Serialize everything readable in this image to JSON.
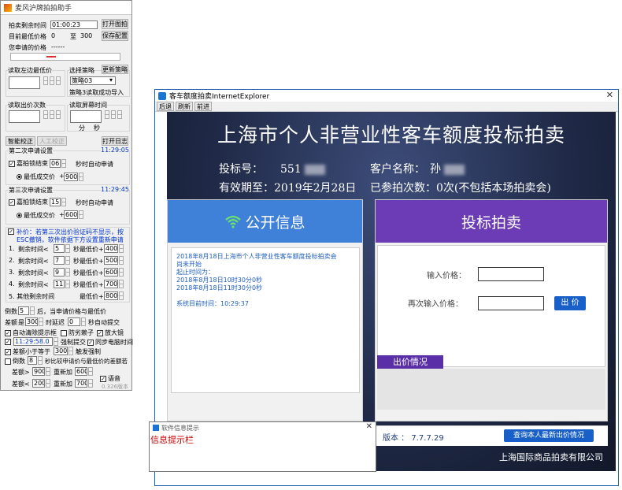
{
  "assistant": {
    "title": "麦风沪牌拍拍助手",
    "remaining_label": "拍卖剩余时间",
    "remaining_value": "01:00:23",
    "open_image_btn": "打开图拍",
    "min_price_label": "目前最低价格",
    "min_price_value": "0",
    "range_sep": "至",
    "range_value": "300",
    "save_config_btn": "保存配置",
    "applied_price_label": "您申请的价格",
    "applied_price_value": "------",
    "read_min_label": "读取左边最低价",
    "strategy_label": "选择策略",
    "update_strategy_btn": "更新策略",
    "strategy_value": "策略03",
    "strategy_status": "策略3读取成功导入",
    "read_bid_label": "读取出价次数",
    "read_screen_label": "读取屏幕时间",
    "minute_label": "分",
    "second_label": "秒",
    "calibrate_btn": "智能校正",
    "manual_btn": "人工校正",
    "open_log_btn": "打开日志",
    "second_apply": {
      "label": "第二次申请设置",
      "time": "11:29:05",
      "end_label": "嘉拍锁结束",
      "end_value": "06",
      "auto_label": "秒时自动申请",
      "lowest_label": "最低成交价",
      "plus": "+",
      "add_value": "900"
    },
    "third_apply": {
      "label": "第三次申请设置",
      "time": "11:29:45",
      "end_label": "嘉拍锁结束",
      "end_value": "15",
      "auto_label": "秒时自动申请",
      "lowest_label": "最低成交价",
      "plus": "+",
      "add_value": "600"
    },
    "supplement_text_1": "补价：若第三次出价验证码不显示，按",
    "supplement_text_2": "ESC撤销，软件依据下方设置重新申请",
    "rules": [
      {
        "n": "1.",
        "label": "剩余时间<",
        "sec": "5",
        "mid": "秒最低价+",
        "add": "400"
      },
      {
        "n": "2.",
        "label": "剩余时间<",
        "sec": "7",
        "mid": "秒最低价+",
        "add": "500"
      },
      {
        "n": "3.",
        "label": "剩余时间<",
        "sec": "9",
        "mid": "秒最低价+",
        "add": "600"
      },
      {
        "n": "4.",
        "label": "剩余时间<",
        "sec": "11",
        "mid": "秒最低价+",
        "add": "700"
      }
    ],
    "rule5_label": "5.  其他剩余时间",
    "rule5_mid": "最低价+",
    "rule5_value": "800",
    "countdown_label": "倒数",
    "countdown_value": "5",
    "countdown_text": "后，当申请价格与最低价",
    "diff_label": "差额",
    "diff_op": "是",
    "diff_value": "300",
    "delay_label": "时延迟",
    "delay_value": "0",
    "auto_submit": "秒自动提交",
    "auto_clear": "自动清除提示框",
    "anti_ai": "防劣赖子",
    "zoom": "放大镜",
    "force_time": "11:29:58.0",
    "force_submit": "强制提交",
    "sync_time": "同步电脑时间",
    "diff_small_label": "差额小于等于",
    "diff_small_value": "300",
    "force_trigger": "触发强制",
    "countdown2_label": "倒数",
    "countdown2_value": "8",
    "countdown2_text": "秒比较申请价与最低价的差额若",
    "gt_label": "差额>",
    "gt_value": "900",
    "gt_add": "重新加",
    "gt_add_value": "600",
    "lt_label": "差额<",
    "lt_value": "200",
    "lt_add": "重新加",
    "lt_add_value": "700",
    "voice_label": "语音",
    "version": "0.326版本"
  },
  "ie": {
    "title": "客车额度拍卖InternetExplorer",
    "nav": [
      "后退",
      "刷新",
      "前进"
    ],
    "heading": "上海市个人非营业性客车额度投标拍卖",
    "bid_no_label": "投标号：",
    "bid_no_value": "551",
    "customer_label": "客户名称：",
    "customer_value": "孙",
    "valid_label": "有效期至：2019年2月28日",
    "count_label": "已参拍次数：0次(不包括本场拍卖会)",
    "public_title": "公开信息",
    "public_lines": [
      "2018年8月18日上海市个人非营业性客车额度投标拍卖会",
      "尚未开始",
      "起止时间为：",
      "2018年8月18日10时30分0秒",
      "2018年8月18日11时30分0秒",
      "",
      "系统目前时间：10:29:37"
    ],
    "bid_title": "投标拍卖",
    "input_price_label": "输入价格：",
    "reinput_price_label": "再次输入价格：",
    "submit_btn": "出 价",
    "situation_label": "出价情况",
    "version_label": "版本 ： 7.7.7.29",
    "query_btn": "查询本人最新出价情况",
    "footer": "上海国际商品拍卖有限公司"
  },
  "dialog": {
    "title": "软件信息提示",
    "message": "信息提示栏"
  }
}
